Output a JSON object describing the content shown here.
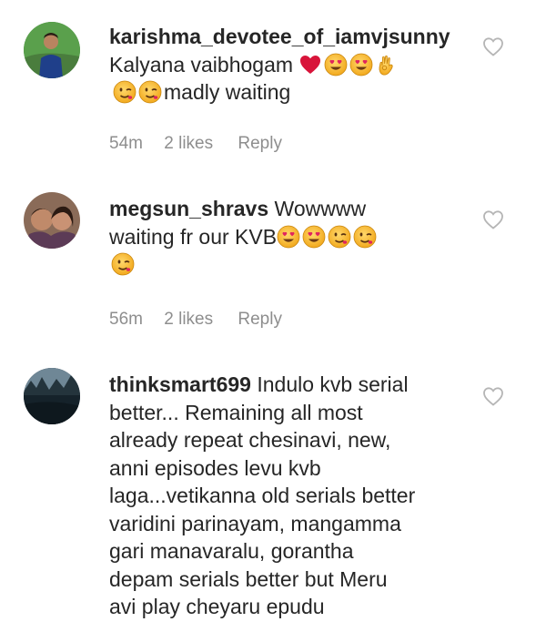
{
  "comments": [
    {
      "username": "karishma_devotee_of_iamvjsunny",
      "text_line1": "Kalyana vaibhogam",
      "text_line2": "madly waiting",
      "emojis_line1": [
        "red-heart",
        "heart-eyes",
        "heart-eyes",
        "ok-hand"
      ],
      "emojis_line2": [
        "wink",
        "wink"
      ],
      "time": "54m",
      "likes": "2 likes",
      "reply": "Reply"
    },
    {
      "username": "megsun_shravs",
      "text_line1": "Wowwww",
      "text_line2": "waiting fr our KVB",
      "emojis_line2": [
        "heart-eyes",
        "heart-eyes",
        "wink",
        "wink"
      ],
      "emojis_line3": [
        "wink"
      ],
      "time": "56m",
      "likes": "2 likes",
      "reply": "Reply"
    },
    {
      "username": "thinksmart699",
      "lines": [
        "Indulo kvb serial",
        "better... Remaining all most",
        "already repeat chesinavi, new,",
        "anni episodes levu kvb",
        "laga...vetikanna old serials better",
        "varidini parinayam, mangamma",
        "gari manavaralu, gorantha",
        "depam serials better but Meru",
        "avi play cheyaru epudu"
      ]
    }
  ],
  "colors": {
    "text": "#262626",
    "meta": "#8e8e8e",
    "heart_outline": "#b5b5b5",
    "heart_red": "#d8143a",
    "emoji_yellow": "#f7b733"
  }
}
